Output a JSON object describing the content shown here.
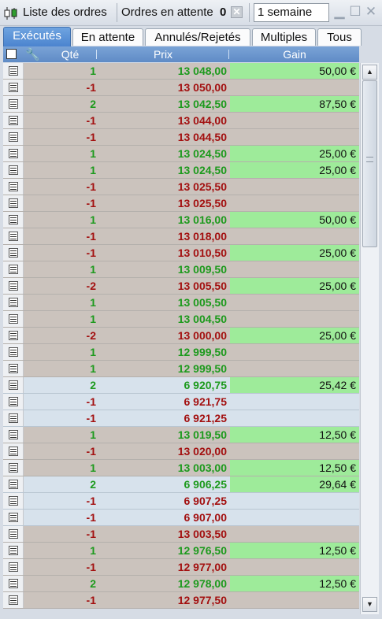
{
  "titlebar": {
    "title": "Liste des ordres",
    "pending_label": "Ordres en attente",
    "pending_count": "0",
    "period": "1 semaine"
  },
  "tabs": [
    {
      "label": "Exécutés",
      "active": true
    },
    {
      "label": "En attente",
      "active": false
    },
    {
      "label": "Annulés/Rejetés",
      "active": false
    },
    {
      "label": "Multiples",
      "active": false
    },
    {
      "label": "Tous",
      "active": false
    }
  ],
  "grid": {
    "headers": {
      "qty": "Qté",
      "price": "Prix",
      "gain": "Gain"
    },
    "rows": [
      {
        "qty": "1",
        "price": "13 048,00",
        "gain": "50,00 €",
        "style": "gray"
      },
      {
        "qty": "-1",
        "price": "13 050,00",
        "gain": "",
        "style": "gray"
      },
      {
        "qty": "2",
        "price": "13 042,50",
        "gain": "87,50 €",
        "style": "gray"
      },
      {
        "qty": "-1",
        "price": "13 044,00",
        "gain": "",
        "style": "gray"
      },
      {
        "qty": "-1",
        "price": "13 044,50",
        "gain": "",
        "style": "gray"
      },
      {
        "qty": "1",
        "price": "13 024,50",
        "gain": "25,00 €",
        "style": "gray"
      },
      {
        "qty": "1",
        "price": "13 024,50",
        "gain": "25,00 €",
        "style": "gray"
      },
      {
        "qty": "-1",
        "price": "13 025,50",
        "gain": "",
        "style": "gray"
      },
      {
        "qty": "-1",
        "price": "13 025,50",
        "gain": "",
        "style": "gray"
      },
      {
        "qty": "1",
        "price": "13 016,00",
        "gain": "50,00 €",
        "style": "gray"
      },
      {
        "qty": "-1",
        "price": "13 018,00",
        "gain": "",
        "style": "gray"
      },
      {
        "qty": "-1",
        "price": "13 010,50",
        "gain": "25,00 €",
        "style": "gray"
      },
      {
        "qty": "1",
        "price": "13 009,50",
        "gain": "",
        "style": "gray"
      },
      {
        "qty": "-2",
        "price": "13 005,50",
        "gain": "25,00 €",
        "style": "gray"
      },
      {
        "qty": "1",
        "price": "13 005,50",
        "gain": "",
        "style": "gray"
      },
      {
        "qty": "1",
        "price": "13 004,50",
        "gain": "",
        "style": "gray"
      },
      {
        "qty": "-2",
        "price": "13 000,00",
        "gain": "25,00 €",
        "style": "gray"
      },
      {
        "qty": "1",
        "price": "12 999,50",
        "gain": "",
        "style": "gray"
      },
      {
        "qty": "1",
        "price": "12 999,50",
        "gain": "",
        "style": "gray"
      },
      {
        "qty": "2",
        "price": "6 920,75",
        "gain": "25,42 €",
        "style": "blue"
      },
      {
        "qty": "-1",
        "price": "6 921,75",
        "gain": "",
        "style": "blue"
      },
      {
        "qty": "-1",
        "price": "6 921,25",
        "gain": "",
        "style": "blue"
      },
      {
        "qty": "1",
        "price": "13 019,50",
        "gain": "12,50 €",
        "style": "gray"
      },
      {
        "qty": "-1",
        "price": "13 020,00",
        "gain": "",
        "style": "gray"
      },
      {
        "qty": "1",
        "price": "13 003,00",
        "gain": "12,50 €",
        "style": "gray"
      },
      {
        "qty": "2",
        "price": "6 906,25",
        "gain": "29,64 €",
        "style": "blue"
      },
      {
        "qty": "-1",
        "price": "6 907,25",
        "gain": "",
        "style": "blue"
      },
      {
        "qty": "-1",
        "price": "6 907,00",
        "gain": "",
        "style": "blue"
      },
      {
        "qty": "-1",
        "price": "13 003,50",
        "gain": "",
        "style": "gray"
      },
      {
        "qty": "1",
        "price": "12 976,50",
        "gain": "12,50 €",
        "style": "gray"
      },
      {
        "qty": "-1",
        "price": "12 977,00",
        "gain": "",
        "style": "gray"
      },
      {
        "qty": "2",
        "price": "12 978,00",
        "gain": "12,50 €",
        "style": "gray"
      },
      {
        "qty": "-1",
        "price": "12 977,50",
        "gain": "",
        "style": "gray"
      }
    ]
  },
  "colors": {
    "positive": "#1d9a1d",
    "negative": "#a31010",
    "gain_fill": "#9eeb9a",
    "active_tab": "#4b84cf",
    "header": "#6a95cd"
  }
}
